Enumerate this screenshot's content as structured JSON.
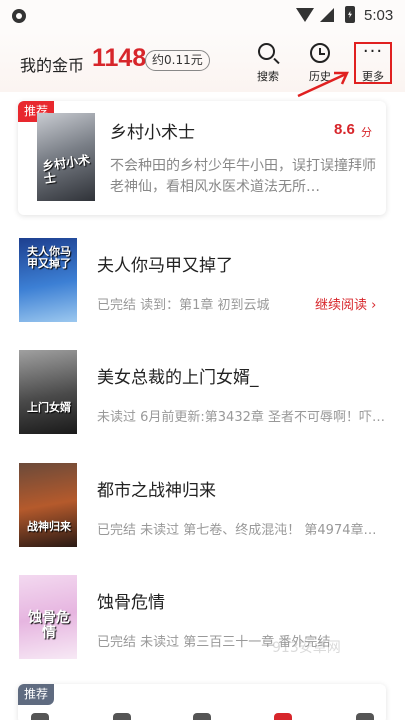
{
  "status_bar": {
    "time": "5:03",
    "icons": [
      "app-notification-icon",
      "wifi-icon",
      "signal-icon",
      "battery-charging-icon"
    ]
  },
  "header": {
    "coins_label": "我的金币",
    "coins_value": "1148",
    "coins_yuan": "约0.11元",
    "search_label": "搜索",
    "history_label": "历史",
    "more_label": "更多",
    "more_icon": "···"
  },
  "accent_color": "#d7262b",
  "annotation_color": "#e02020",
  "recommended": {
    "tag": "推荐",
    "title": "乡村小术士",
    "score": "8.6",
    "score_unit": "分",
    "description": "不会种田的乡村少年牛小田，误打误撞拜师老神仙，看相风水医术道法无所…",
    "cover_text": "乡村小术士"
  },
  "books": [
    {
      "title": "夫人你马甲又掉了",
      "meta": "已完结 读到：第1章 初到云城",
      "action": "继续阅读 ›",
      "cover_text": "夫人你马甲又掉了"
    },
    {
      "title": "美女总裁的上门女婿_",
      "meta": "未读过 6月前更新:第3432章 圣者不可辱啊！吓…",
      "cover_text": "上门女婿"
    },
    {
      "title": "都市之战神归来",
      "meta": "已完结 未读过 第七卷、终成混沌！ 第4974章…",
      "cover_text": "战神归来"
    },
    {
      "title": "蚀骨危情",
      "meta": "已完结 未读过 第三百三十一章 番外完结",
      "cover_text": "蚀骨危情"
    }
  ],
  "watermark": "913安卓网",
  "second_card_tag": "推荐"
}
